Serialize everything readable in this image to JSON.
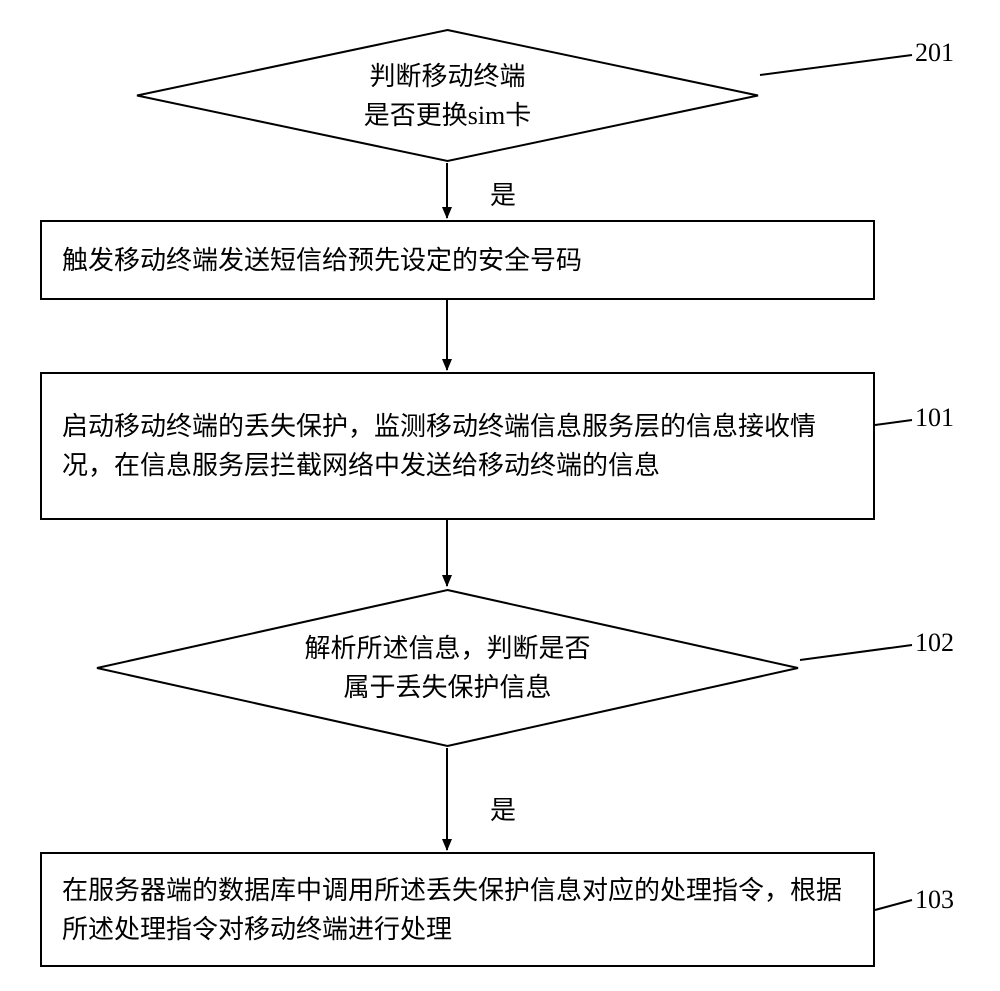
{
  "diagram": {
    "decision1": {
      "line1": "判断移动终端",
      "line2": "是否更换sim卡"
    },
    "edge1_label": "是",
    "step_sms": "触发移动终端发送短信给预先设定的安全号码",
    "step_monitor": "启动移动终端的丢失保护，监测移动终端信息服务层的信息接收情况，在信息服务层拦截网络中发送给移动终端的信息",
    "decision2": {
      "line1": "解析所述信息，判断是否",
      "line2": "属于丢失保护信息"
    },
    "edge2_label": "是",
    "step_process": "在服务器端的数据库中调用所述丢失保护信息对应的处理指令，根据所述处理指令对移动终端进行处理",
    "ref_labels": {
      "r201": "201",
      "r101": "101",
      "r102": "102",
      "r103": "103"
    }
  }
}
